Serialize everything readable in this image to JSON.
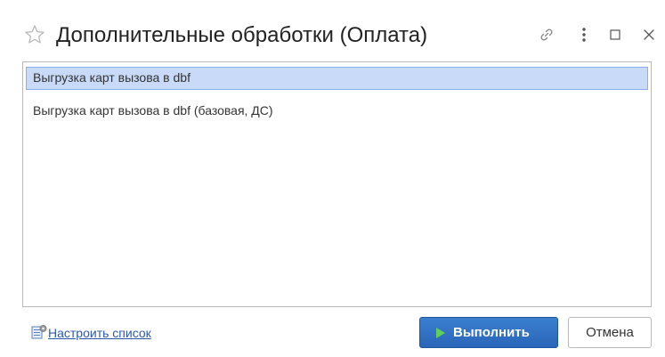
{
  "window": {
    "title": "Дополнительные обработки (Оплата)"
  },
  "list": {
    "items": [
      {
        "label": "Выгрузка карт вызова в dbf",
        "selected": true
      },
      {
        "label": "Выгрузка карт вызова в dbf (базовая, ДС)",
        "selected": false
      }
    ]
  },
  "footer": {
    "settings_link": "Настроить список",
    "run_label": "Выполнить",
    "cancel_label": "Отмена"
  },
  "colors": {
    "accent": "#2a65b8",
    "selection": "#c8daf8",
    "link": "#2c5aa8"
  },
  "icons": {
    "title_star": "star-icon",
    "link": "link-icon",
    "more": "more-vertical-icon",
    "maximize": "maximize-icon",
    "close": "close-icon",
    "settings": "list-settings-icon",
    "run": "play-icon"
  }
}
